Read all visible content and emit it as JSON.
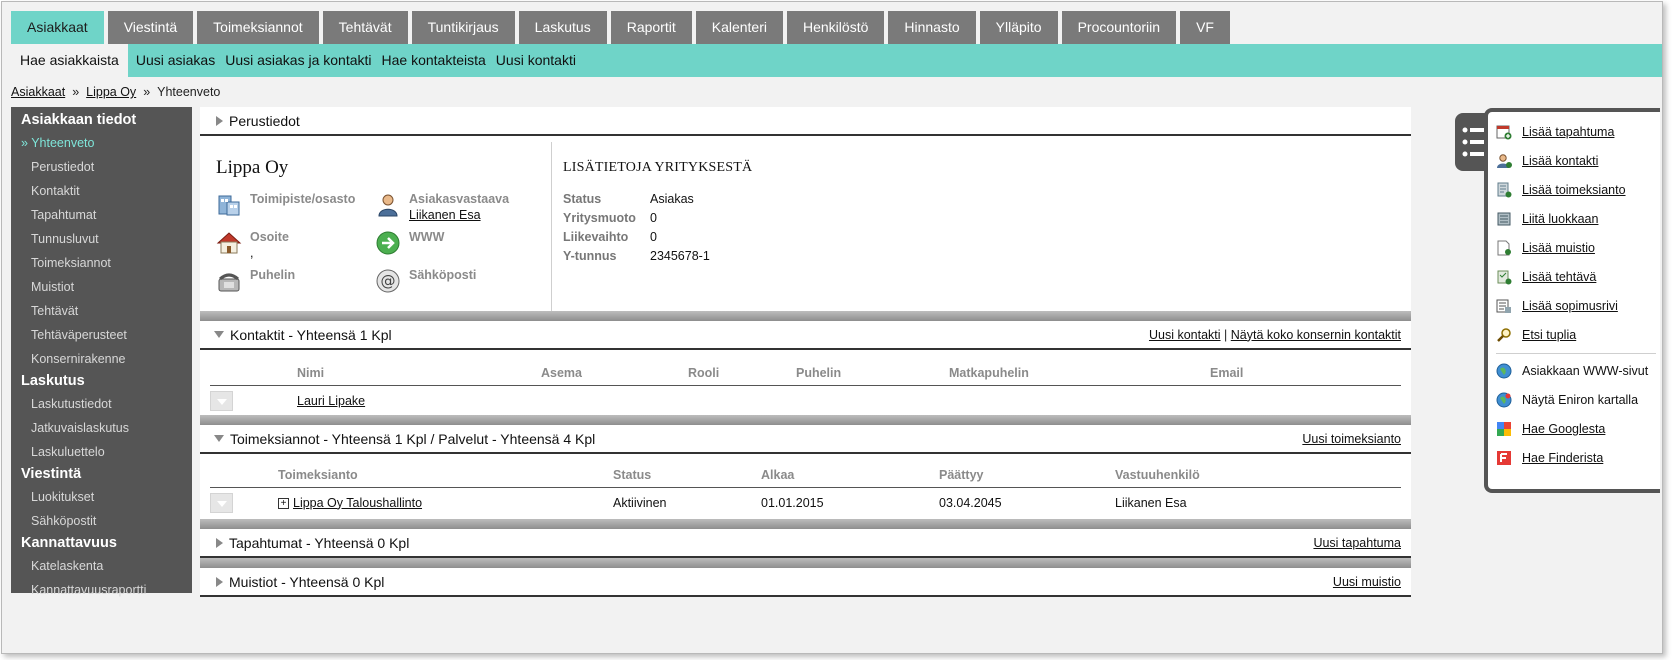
{
  "nav": {
    "tabs": [
      "Asiakkaat",
      "Viestintä",
      "Toimeksiannot",
      "Tehtävät",
      "Tuntikirjaus",
      "Laskutus",
      "Raportit",
      "Kalenteri",
      "Henkilöstö",
      "Hinnasto",
      "Ylläpito",
      "Procountoriin",
      "VF"
    ],
    "subnav": [
      "Hae asiakkaista",
      "Uusi asiakas",
      "Uusi asiakas ja kontakti",
      "Hae kontakteista",
      "Uusi kontakti"
    ]
  },
  "breadcrumb": {
    "root": "Asiakkaat",
    "company": "Lippa Oy",
    "current": "Yhteenveto",
    "sep": "»"
  },
  "sidebar": {
    "sections": [
      {
        "title": "Asiakkaan tiedot",
        "items": [
          "Yhteenveto",
          "Perustiedot",
          "Kontaktit",
          "Tapahtumat",
          "Tunnusluvut",
          "Toimeksiannot",
          "Muistiot",
          "Tehtävät",
          "Tehtäväperusteet",
          "Konsernirakenne"
        ]
      },
      {
        "title": "Laskutus",
        "items": [
          "Laskutustiedot",
          "Jatkuvaislaskutus",
          "Laskuluettelo"
        ]
      },
      {
        "title": "Viestintä",
        "items": [
          "Luokitukset",
          "Sähköpostit"
        ]
      },
      {
        "title": "Kannattavuus",
        "items": [
          "Katelaskenta",
          "Kannattavuusraportti"
        ]
      }
    ]
  },
  "basic": {
    "title": "Perustiedot",
    "company_name": "Lippa Oy",
    "office_label": "Toimipiste/osasto",
    "owner_label": "Asiakasvastaava",
    "owner_value": "Liikanen Esa",
    "address_label": "Osoite",
    "address_value": ",",
    "www_label": "WWW",
    "phone_label": "Puhelin",
    "email_label": "Sähköposti"
  },
  "extra": {
    "title": "LISÄTIETOJA YRITYKSESTÄ",
    "rows": [
      {
        "k": "Status",
        "v": "Asiakas"
      },
      {
        "k": "Yritysmuoto",
        "v": "0"
      },
      {
        "k": "Liikevaihto",
        "v": "0"
      },
      {
        "k": "Y-tunnus",
        "v": "2345678-1"
      }
    ]
  },
  "contacts": {
    "title": "Kontaktit - Yhteensä 1 Kpl",
    "link_new": "Uusi kontakti",
    "link_sep": "|",
    "link_all": "Näytä koko konsernin kontaktit",
    "columns": [
      "Nimi",
      "Asema",
      "Rooli",
      "Puhelin",
      "Matkapuhelin",
      "Email"
    ],
    "rows": [
      {
        "name": "Lauri Lipake"
      }
    ]
  },
  "assignments": {
    "title": "Toimeksiannot - Yhteensä 1 Kpl / Palvelut - Yhteensä 4 Kpl",
    "link_new": "Uusi toimeksianto",
    "columns": [
      "Toimeksianto",
      "Status",
      "Alkaa",
      "Päättyy",
      "Vastuuhenkilö"
    ],
    "rows": [
      {
        "name": "Lippa Oy Taloushallinto",
        "status": "Aktiivinen",
        "start": "01.01.2015",
        "end": "03.04.2045",
        "owner": "Liikanen Esa"
      }
    ]
  },
  "events": {
    "title": "Tapahtumat - Yhteensä 0 Kpl",
    "link_new": "Uusi tapahtuma"
  },
  "memos": {
    "title": "Muistiot - Yhteensä 0 Kpl",
    "link_new": "Uusi muistio"
  },
  "actions": {
    "group1": [
      {
        "label": "Lisää tapahtuma",
        "icon": "event-add-icon"
      },
      {
        "label": "Lisää kontakti",
        "icon": "contact-add-icon"
      },
      {
        "label": "Lisää toimeksianto",
        "icon": "assignment-add-icon"
      },
      {
        "label": "Liitä luokkaan",
        "icon": "category-icon"
      },
      {
        "label": "Lisää muistio",
        "icon": "memo-add-icon"
      },
      {
        "label": "Lisää tehtävä",
        "icon": "task-add-icon"
      },
      {
        "label": "Lisää sopimusrivi",
        "icon": "contract-row-icon"
      },
      {
        "label": "Etsi tuplia",
        "icon": "magnifier-icon"
      }
    ],
    "group2": [
      {
        "label": "Asiakkaan WWW-sivut",
        "icon": "globe-icon"
      },
      {
        "label": "Näytä Eniron kartalla",
        "icon": "map-globe-icon"
      },
      {
        "label": "Hae Googlesta",
        "icon": "google-icon"
      },
      {
        "label": "Hae Finderista",
        "icon": "finder-icon"
      }
    ]
  },
  "colors": {
    "accent": "#6fd4c8",
    "tab": "#7a7a7a",
    "sidebar": "#555555",
    "current": "#7fe6da"
  }
}
